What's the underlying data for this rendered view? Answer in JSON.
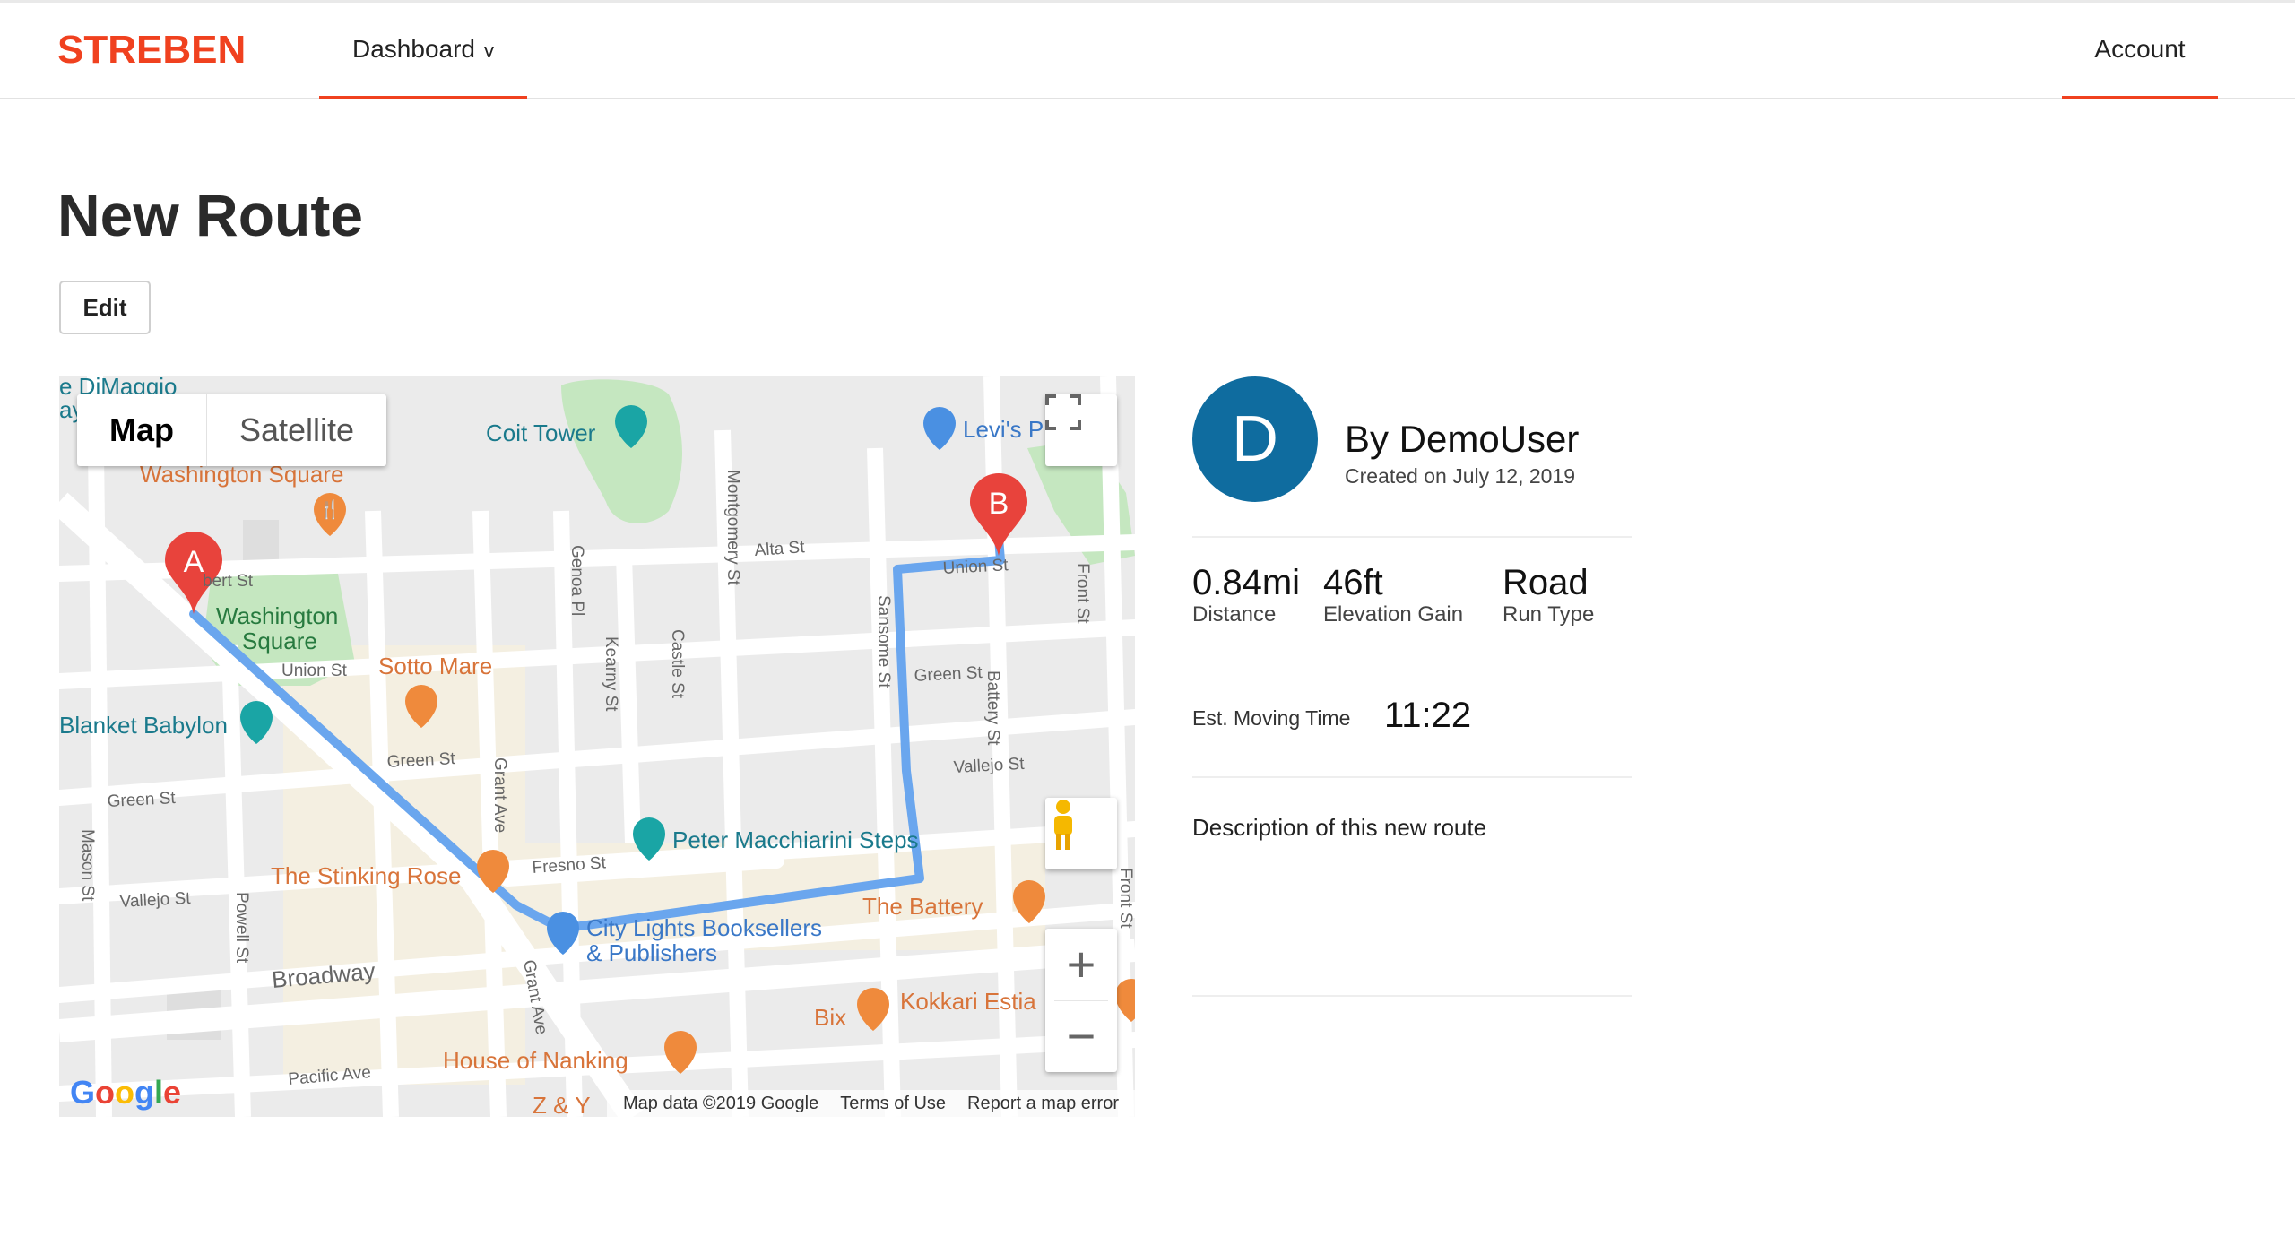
{
  "app": {
    "logo": "STREBEN"
  },
  "nav": {
    "dashboard_label": "Dashboard",
    "dashboard_chevron": "v",
    "account_label": "Account"
  },
  "page": {
    "title": "New Route",
    "edit_label": "Edit"
  },
  "map": {
    "type_map": "Map",
    "type_satellite": "Satellite",
    "zoom_in": "+",
    "zoom_out": "−",
    "markers": {
      "start": "A",
      "end": "B"
    },
    "poi_labels": {
      "washington_square_top": "Washington Square",
      "washington_square_line1": "Washington",
      "washington_square_line2": "Square",
      "coit_tower": "Coit Tower",
      "levis": "Levi's P",
      "sotto_mare": "Sotto Mare",
      "blanket_babylon": "Blanket Babylon",
      "peter_macchiarini": "Peter Macchiarini Steps",
      "stinking_rose": "The Stinking Rose",
      "the_battery": "The Battery",
      "city_lights_1": "City Lights Booksellers",
      "city_lights_2": "& Publishers",
      "bix": "Bix",
      "kokkari": "Kokkari Estia",
      "house_of_nanking": "House of Nanking",
      "dimaggio": "e DiMaggio",
      "dimaggio2": "ay",
      "zy": "Z & Y"
    },
    "street_labels": {
      "filbert": "bert St",
      "union_w": "Union St",
      "union_e": "Union St",
      "green_w": "Green St",
      "green_c": "Green St",
      "green_e": "Green St",
      "vallejo_w": "Vallejo St",
      "vallejo_e": "Vallejo St",
      "fresno": "Fresno St",
      "broadway": "Broadway",
      "pacific": "Pacific Ave",
      "alta": "Alta St",
      "mason": "Mason St",
      "powell": "Powell St",
      "grant_n": "Grant Ave",
      "grant_s": "Grant Ave",
      "genoa": "Genoa Pl",
      "kearny": "Kearny St",
      "castle": "Castle St",
      "montgomery": "Montgomery St",
      "sansome": "Sansome St",
      "battery": "Battery St",
      "front_n": "Front St",
      "front_s": "Front St"
    },
    "google_letters": [
      "G",
      "o",
      "o",
      "g",
      "l",
      "e"
    ],
    "footer": {
      "data": "Map data ©2019 Google",
      "terms": "Terms of Use",
      "report": "Report a map error"
    },
    "icons": [
      "fullscreen-icon",
      "pegman-icon",
      "restaurant-icon",
      "shopping-icon",
      "museum-icon",
      "bar-icon"
    ],
    "colors": {
      "route": "#6aa6ee",
      "park": "#c5e7c0",
      "poi_orange": "#ef8a3c",
      "poi_teal": "#1aa5a5",
      "marker_red": "#e8433c"
    }
  },
  "route": {
    "avatar_initial": "D",
    "author": "By DemoUser",
    "created": "Created on July 12, 2019",
    "stats": [
      {
        "value": "0.84mi",
        "label": "Distance"
      },
      {
        "value": "46ft",
        "label": "Elevation Gain"
      },
      {
        "value": "Road",
        "label": "Run Type"
      }
    ],
    "moving_time_label": "Est. Moving Time",
    "moving_time_value": "11:22",
    "description": "Description of this new route"
  },
  "colors": {
    "brand": "#f0411f",
    "avatar": "#0f6c9f"
  }
}
